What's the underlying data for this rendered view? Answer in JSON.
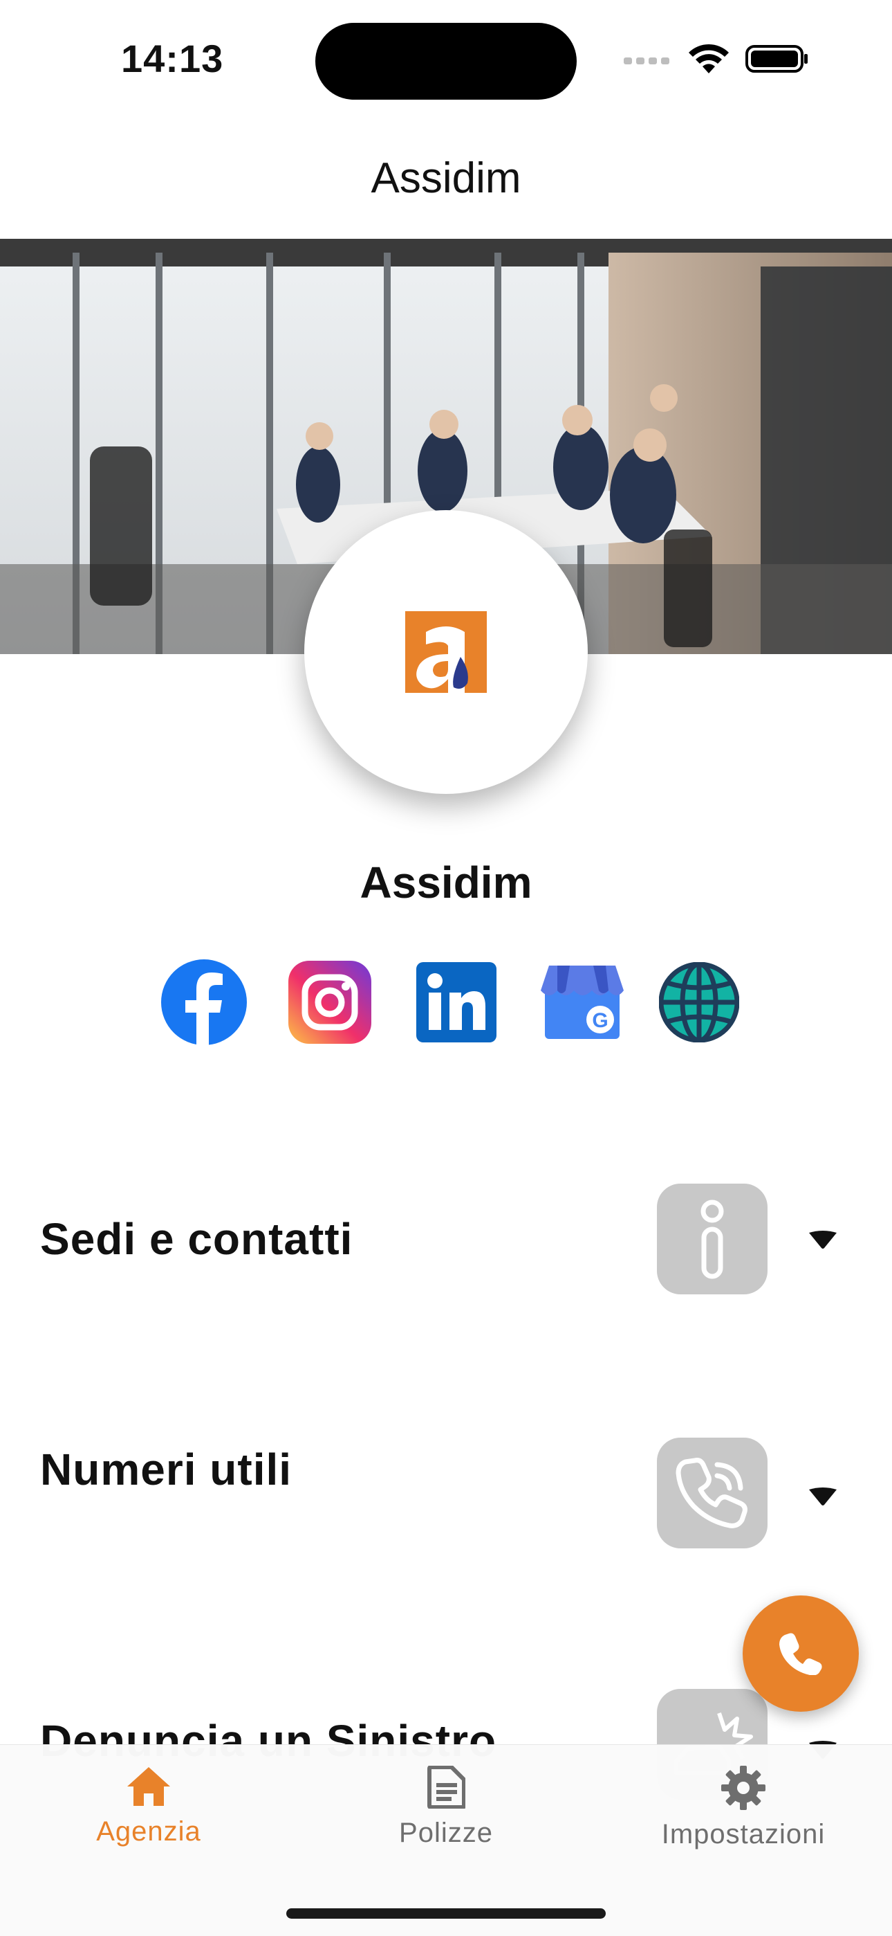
{
  "status_bar": {
    "time": "14:13"
  },
  "nav": {
    "title": "Assidim"
  },
  "agency": {
    "name": "Assidim",
    "logo_letter": "a"
  },
  "socials": [
    {
      "name": "facebook-icon",
      "color": "#1877F2"
    },
    {
      "name": "instagram-icon",
      "color": "#E1306C"
    },
    {
      "name": "linkedin-icon",
      "color": "#0A66C2"
    },
    {
      "name": "google-business-icon",
      "color": "#4285F4"
    },
    {
      "name": "website-globe-icon",
      "color": "#12B3A4"
    }
  ],
  "sections": [
    {
      "title": "Sedi e contatti",
      "icon": "info-icon"
    },
    {
      "title": "Numeri utili",
      "icon": "phone-call-icon"
    },
    {
      "title": "Denuncia un Sinistro",
      "icon": "car-crash-icon"
    }
  ],
  "fab": {
    "icon": "phone-icon",
    "color": "#E8822A"
  },
  "tabs": [
    {
      "label": "Agenzia",
      "icon": "home-icon",
      "active": true
    },
    {
      "label": "Polizze",
      "icon": "document-icon",
      "active": false
    },
    {
      "label": "Impostazioni",
      "icon": "gear-icon",
      "active": false
    }
  ],
  "colors": {
    "accent": "#E8822A",
    "inactive": "#6e6e6e",
    "icon_bg": "#C8C8C8"
  }
}
